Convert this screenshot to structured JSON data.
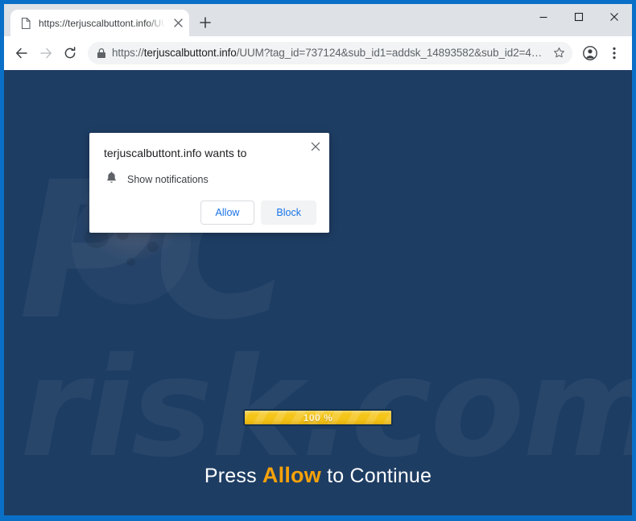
{
  "window": {
    "controls": {
      "minimize": "minimize",
      "maximize": "maximize",
      "close": "close"
    }
  },
  "browser": {
    "tab": {
      "title": "https://terjuscalbuttont.info/UUM",
      "favicon": "page-icon",
      "close_label": "Close tab"
    },
    "new_tab_label": "New tab",
    "nav": {
      "back": "Back",
      "forward": "Forward",
      "reload": "Reload"
    },
    "omnibox": {
      "lock_icon": "lock-icon",
      "url_scheme": "https://",
      "url_host": "terjuscalbuttont.info",
      "url_path": "/UUM?tag_id=737124&sub_id1=addsk_14893582&sub_id2=4…",
      "bookmark_label": "Bookmark this tab"
    },
    "profile_label": "Profile",
    "menu_label": "Customize and control Google Chrome"
  },
  "permission_dialog": {
    "title": "terjuscalbuttont.info wants to",
    "permission_icon": "bell-icon",
    "permission_label": "Show notifications",
    "allow_label": "Allow",
    "block_label": "Block",
    "close_label": "Close"
  },
  "page": {
    "watermark": {
      "line1": "PC",
      "line2": "risk.com"
    },
    "progress": {
      "value": 100,
      "label": "100 %"
    },
    "headline": {
      "before": "Press ",
      "accent": "Allow",
      "after": " to Continue"
    }
  },
  "colors": {
    "window_frame": "#0A6FC6",
    "page_background": "#1e3d63",
    "accent_gold": "#f5a20a",
    "progress_fill": "#f5c518",
    "chrome_link": "#1a73e8",
    "tab_strip": "#dee1e6"
  }
}
